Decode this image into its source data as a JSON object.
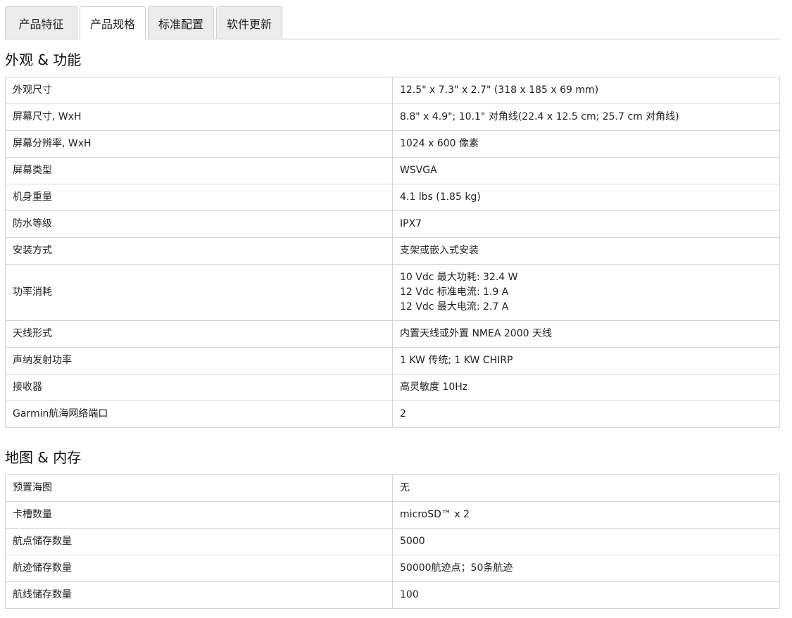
{
  "tabs": [
    {
      "label": "产品特征",
      "active": false
    },
    {
      "label": "产品规格",
      "active": true
    },
    {
      "label": "标准配置",
      "active": false
    },
    {
      "label": "软件更新",
      "active": false
    }
  ],
  "sections": [
    {
      "title": "外观 & 功能",
      "rows": [
        {
          "label": "外观尺寸",
          "value": "12.5\" x 7.3\" x 2.7\" (318 x 185 x 69 mm)"
        },
        {
          "label": "屏幕尺寸, WxH",
          "value": "8.8\" x 4.9\"; 10.1\" 对角线(22.4 x 12.5 cm; 25.7 cm 对角线)"
        },
        {
          "label": "屏幕分辨率, WxH",
          "value": "1024 x 600 像素"
        },
        {
          "label": "屏幕类型",
          "value": "WSVGA"
        },
        {
          "label": "机身重量",
          "value": "4.1 lbs (1.85 kg)"
        },
        {
          "label": "防水等级",
          "value": "IPX7"
        },
        {
          "label": "安装方式",
          "value": "支架或嵌入式安装"
        },
        {
          "label": "功率消耗",
          "lines": [
            "10 Vdc 最大功耗: 32.4 W",
            "12 Vdc 标准电流: 1.9 A",
            "12 Vdc 最大电流: 2.7 A"
          ]
        },
        {
          "label": "天线形式",
          "value": "内置天线或外置 NMEA 2000 天线"
        },
        {
          "label": "声纳发射功率",
          "value": "1 KW 传统; 1 KW CHIRP"
        },
        {
          "label": "接收器",
          "value": "高灵敏度 10Hz"
        },
        {
          "label": "Garmin航海网络端口",
          "value": "2"
        }
      ]
    },
    {
      "title": "地图 & 内存",
      "rows": [
        {
          "label": "预置海图",
          "value": "无"
        },
        {
          "label": "卡槽数量",
          "value": "microSD™ x 2"
        },
        {
          "label": "航点储存数量",
          "value": "5000"
        },
        {
          "label": "航迹储存数量",
          "value": "50000航迹点；50条航迹"
        },
        {
          "label": "航线储存数量",
          "value": "100"
        }
      ]
    }
  ]
}
